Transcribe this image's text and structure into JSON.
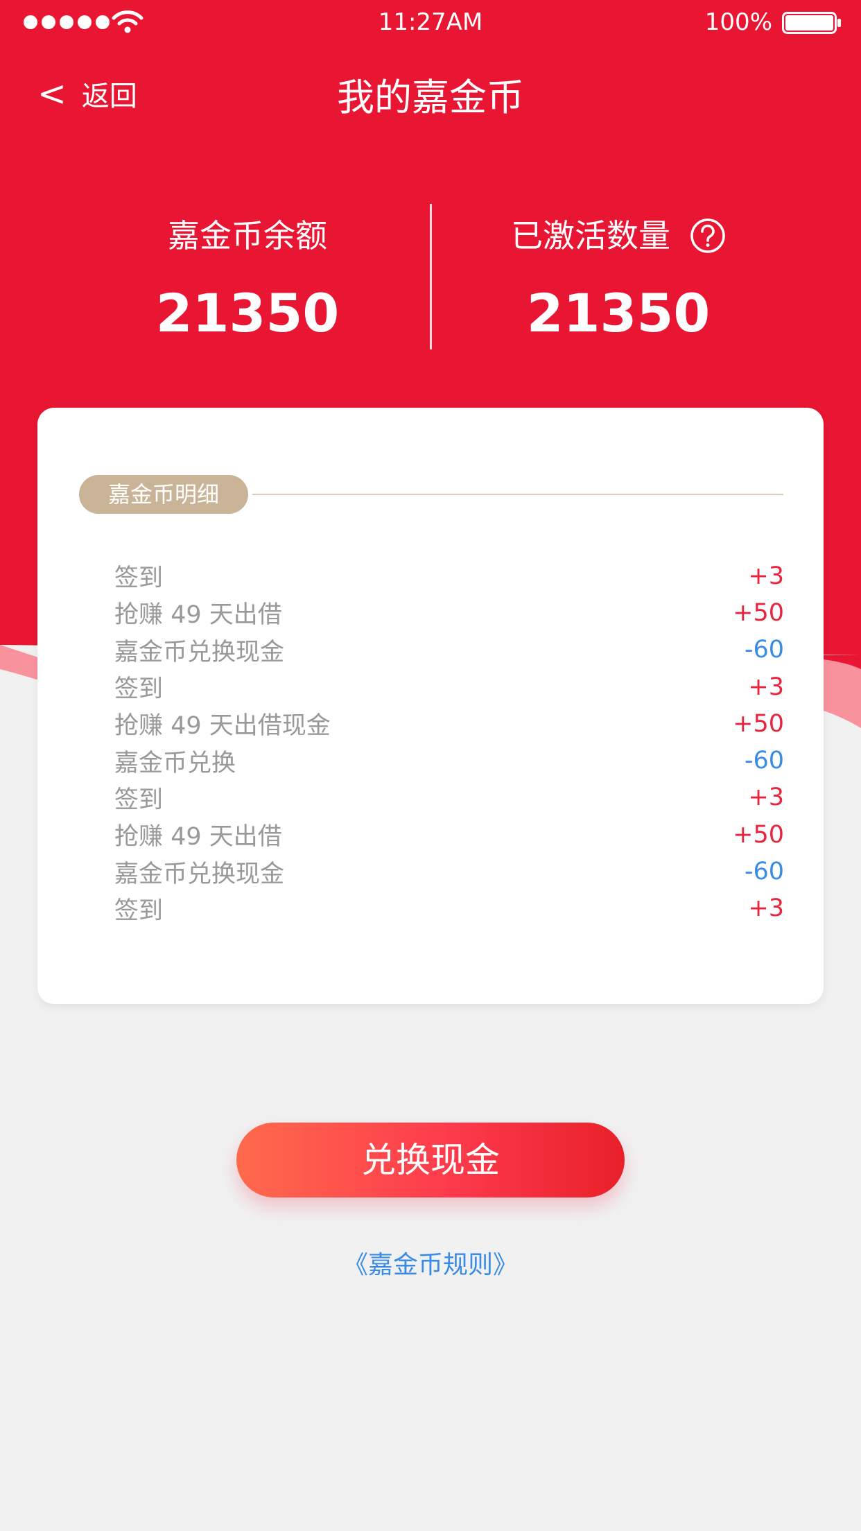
{
  "status_bar": {
    "time": "11:27AM",
    "battery": "100%"
  },
  "nav": {
    "back_chevron": "<",
    "back_label": "返回",
    "title": "我的嘉金币"
  },
  "stats": {
    "balance_label": "嘉金币余额",
    "balance_value": "21350",
    "activated_label": "已激活数量",
    "activated_value": "21350"
  },
  "details": {
    "section_title": "嘉金币明细",
    "records": [
      {
        "label": "签到",
        "amount": "+3"
      },
      {
        "label": "抢赚 49 天出借",
        "amount": "+50"
      },
      {
        "label": "嘉金币兑换现金",
        "amount": "-60"
      },
      {
        "label": "签到",
        "amount": "+3"
      },
      {
        "label": "抢赚 49 天出借现金",
        "amount": "+50"
      },
      {
        "label": "嘉金币兑换",
        "amount": "-60"
      },
      {
        "label": "签到",
        "amount": "+3"
      },
      {
        "label": "抢赚 49 天出借",
        "amount": "+50"
      },
      {
        "label": "嘉金币兑换现金",
        "amount": "-60"
      },
      {
        "label": "签到",
        "amount": "+3"
      }
    ]
  },
  "actions": {
    "exchange_label": "兑换现金",
    "rules_link": "《嘉金币规则》"
  },
  "icons": {
    "wifi": "wifi-icon",
    "battery": "battery-icon",
    "help": "help-icon",
    "signal": "signal-icon"
  },
  "colors": {
    "brand_red": "#e81633",
    "positive": "#e8253f",
    "negative": "#3a8be6",
    "pill": "#c9b497"
  }
}
